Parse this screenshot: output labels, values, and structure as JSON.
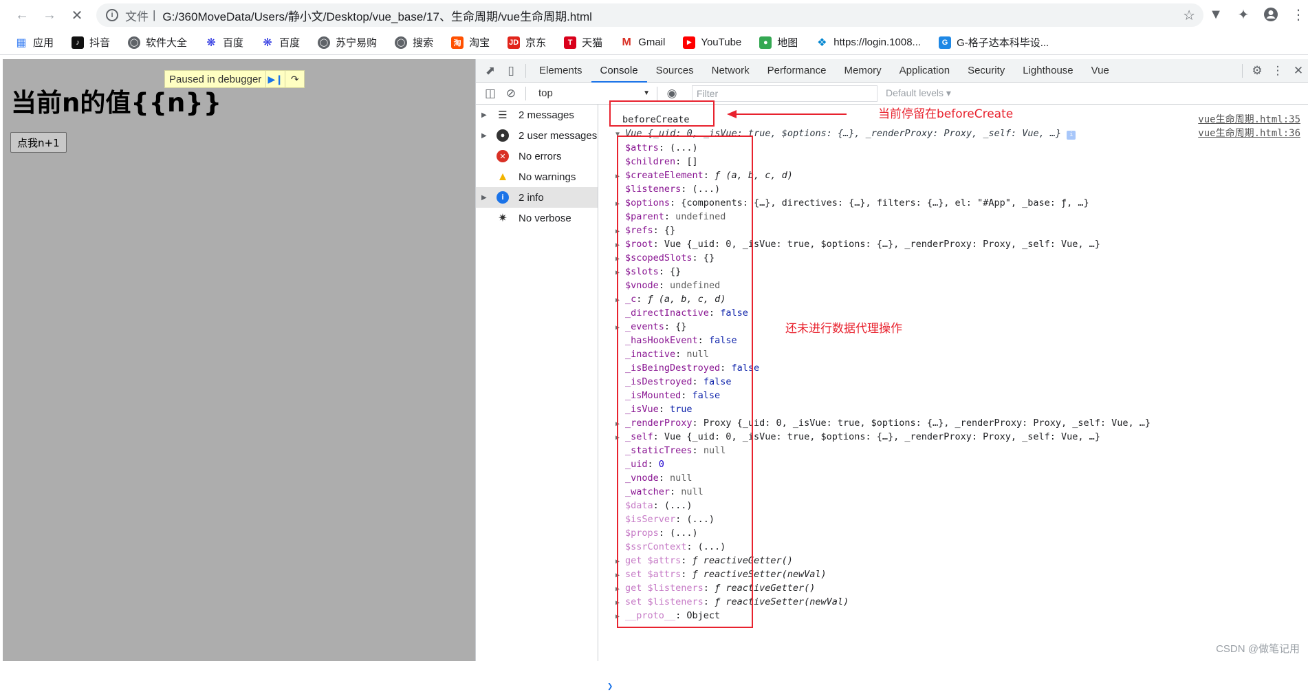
{
  "browser": {
    "url_protocol": "文件",
    "url_path": "G:/360MoveData/Users/静小文/Desktop/vue_base/17、生命周期/vue生命周期.html",
    "bookmarks": [
      "应用",
      "抖音",
      "软件大全",
      "百度",
      "百度",
      "苏宁易购",
      "搜索",
      "淘宝",
      "京东",
      "天猫",
      "Gmail",
      "YouTube",
      "地图",
      "https://login.1008...",
      "G-格子达本科毕设..."
    ]
  },
  "page": {
    "heading": "当前n的值{{n}}",
    "button_label": "点我n+1",
    "paused_label": "Paused in debugger"
  },
  "devtools": {
    "tabs": [
      "Elements",
      "Console",
      "Sources",
      "Network",
      "Performance",
      "Memory",
      "Application",
      "Security",
      "Lighthouse",
      "Vue"
    ],
    "context": "top",
    "filter_placeholder": "Filter",
    "levels": "Default levels ▾",
    "sidebar": [
      {
        "label": "2 messages",
        "icon": "list-icon"
      },
      {
        "label": "2 user messages",
        "icon": "user-icon"
      },
      {
        "label": "No errors",
        "icon": "error-icon"
      },
      {
        "label": "No warnings",
        "icon": "warning-icon"
      },
      {
        "label": "2 info",
        "icon": "info-icon"
      },
      {
        "label": "No verbose",
        "icon": "bug-icon"
      }
    ],
    "log1": {
      "text": "beforeCreate",
      "source": "vue生命周期.html:35"
    },
    "log2": {
      "summary": "Vue {_uid: 0, _isVue: true, $options: {…}, _renderProxy: Proxy, _self: Vue, …}",
      "source": "vue生命周期.html:36"
    },
    "tree": [
      {
        "t": 0,
        "k": "$attrs",
        "v": "(...)"
      },
      {
        "t": 0,
        "k": "$children",
        "v": "[]"
      },
      {
        "t": 1,
        "k": "$createElement",
        "v": "ƒ (a, b, c, d)",
        "c": "fn"
      },
      {
        "t": 0,
        "k": "$listeners",
        "v": "(...)"
      },
      {
        "t": 1,
        "k": "$options",
        "v": "{components: {…}, directives: {…}, filters: {…}, el: \"#App\", _base: ƒ, …}"
      },
      {
        "t": 0,
        "k": "$parent",
        "v": "undefined",
        "c": "nul"
      },
      {
        "t": 1,
        "k": "$refs",
        "v": "{}"
      },
      {
        "t": 1,
        "k": "$root",
        "v": "Vue {_uid: 0, _isVue: true, $options: {…}, _renderProxy: Proxy, _self: Vue, …}"
      },
      {
        "t": 1,
        "k": "$scopedSlots",
        "v": "{}"
      },
      {
        "t": 1,
        "k": "$slots",
        "v": "{}"
      },
      {
        "t": 0,
        "k": "$vnode",
        "v": "undefined",
        "c": "nul"
      },
      {
        "t": 1,
        "k": "_c",
        "v": "ƒ (a, b, c, d)",
        "c": "fn"
      },
      {
        "t": 0,
        "k": "_directInactive",
        "v": "false",
        "c": "kw"
      },
      {
        "t": 1,
        "k": "_events",
        "v": "{}"
      },
      {
        "t": 0,
        "k": "_hasHookEvent",
        "v": "false",
        "c": "kw"
      },
      {
        "t": 0,
        "k": "_inactive",
        "v": "null",
        "c": "nul"
      },
      {
        "t": 0,
        "k": "_isBeingDestroyed",
        "v": "false",
        "c": "kw"
      },
      {
        "t": 0,
        "k": "_isDestroyed",
        "v": "false",
        "c": "kw"
      },
      {
        "t": 0,
        "k": "_isMounted",
        "v": "false",
        "c": "kw"
      },
      {
        "t": 0,
        "k": "_isVue",
        "v": "true",
        "c": "kw"
      },
      {
        "t": 1,
        "k": "_renderProxy",
        "v": "Proxy {_uid: 0, _isVue: true, $options: {…}, _renderProxy: Proxy, _self: Vue, …}"
      },
      {
        "t": 1,
        "k": "_self",
        "v": "Vue {_uid: 0, _isVue: true, $options: {…}, _renderProxy: Proxy, _self: Vue, …}"
      },
      {
        "t": 0,
        "k": "_staticTrees",
        "v": "null",
        "c": "nul"
      },
      {
        "t": 0,
        "k": "_uid",
        "v": "0",
        "c": "num"
      },
      {
        "t": 0,
        "k": "_vnode",
        "v": "null",
        "c": "nul"
      },
      {
        "t": 0,
        "k": "_watcher",
        "v": "null",
        "c": "nul"
      },
      {
        "t": 0,
        "k": "$data",
        "v": "(...)",
        "dim": true
      },
      {
        "t": 0,
        "k": "$isServer",
        "v": "(...)",
        "dim": true
      },
      {
        "t": 0,
        "k": "$props",
        "v": "(...)",
        "dim": true
      },
      {
        "t": 0,
        "k": "$ssrContext",
        "v": "(...)",
        "dim": true
      },
      {
        "t": 1,
        "k": "get $attrs",
        "v": "ƒ reactiveGetter()",
        "c": "fn",
        "dim": true
      },
      {
        "t": 1,
        "k": "set $attrs",
        "v": "ƒ reactiveSetter(newVal)",
        "c": "fn",
        "dim": true
      },
      {
        "t": 1,
        "k": "get $listeners",
        "v": "ƒ reactiveGetter()",
        "c": "fn",
        "dim": true
      },
      {
        "t": 1,
        "k": "set $listeners",
        "v": "ƒ reactiveSetter(newVal)",
        "c": "fn",
        "dim": true
      },
      {
        "t": 1,
        "k": "__proto__",
        "v": "Object",
        "dim": true
      }
    ]
  },
  "annotations": {
    "note1": "当前停留在beforeCreate",
    "note2": "还未进行数据代理操作"
  },
  "watermark": "CSDN @做笔记用",
  "colors": {
    "accent": "#1a73e8",
    "annotation": "#e8222e"
  }
}
